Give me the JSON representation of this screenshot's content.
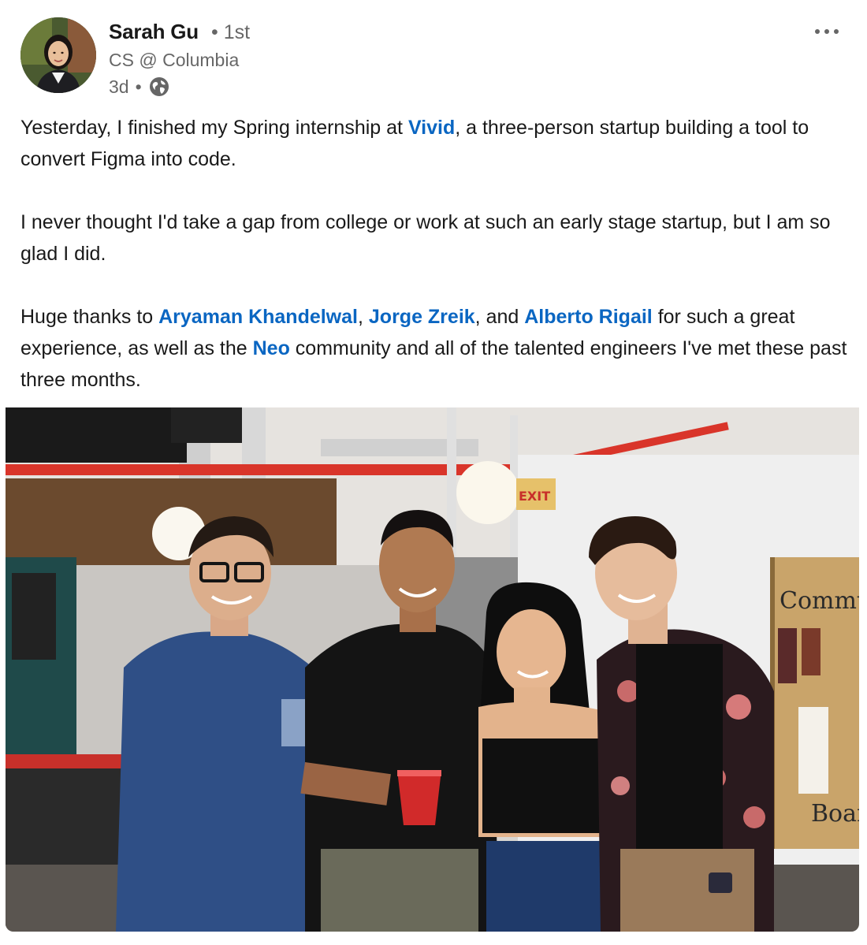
{
  "author": {
    "name": "Sarah Gu",
    "degree": "• 1st",
    "headline": "CS @ Columbia",
    "time": "3d",
    "separator": "•",
    "visibility_icon": "globe-icon"
  },
  "menu": {
    "icon": "ellipsis-icon"
  },
  "post": {
    "p1": {
      "t1": "Yesterday, I finished my Spring internship at ",
      "m1": "Vivid",
      "t2": ", a three-person startup building a tool to convert Figma into code."
    },
    "p2": {
      "t1": "I never thought I'd take a gap from college or work at such an early stage startup, but I am so glad I did."
    },
    "p3": {
      "t1": "Huge thanks to ",
      "m1": "Aryaman Khandelwal",
      "t2": ", ",
      "m2": "Jorge Zreik",
      "t3": ", and ",
      "m3": "Alberto Rigail",
      "t4": " for such a great experience, as well as the ",
      "m4": "Neo",
      "t5": " community and all of the talented engineers I've met these past three months."
    }
  },
  "photo": {
    "exit_sign": "EXIT",
    "board_text_top": "Commun",
    "board_text_bottom": "Boar"
  },
  "colors": {
    "mention": "#0a66c2",
    "secondary_text": "#666666",
    "primary_text": "#191919"
  }
}
